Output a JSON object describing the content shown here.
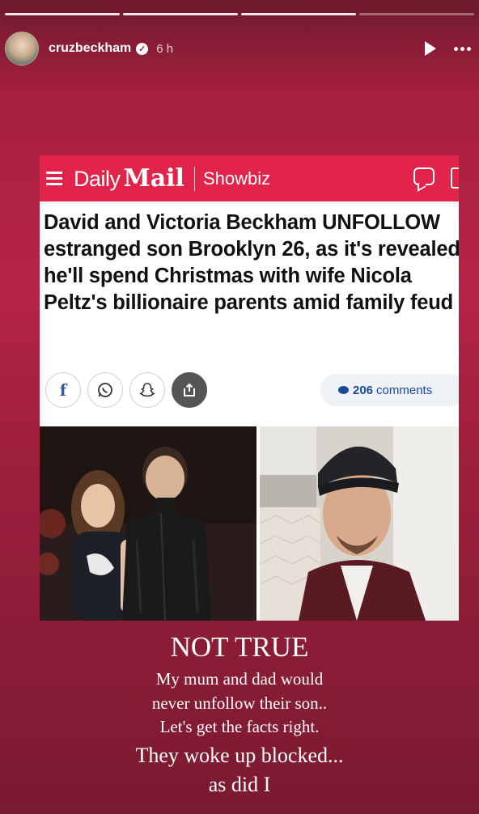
{
  "story": {
    "username": "cruzbeckham",
    "time": "6 h"
  },
  "article": {
    "brand_daily": "Daily",
    "brand_mail": "Mail",
    "section": "Showbiz",
    "headline": "David and Victoria Beckham UNFOLLOW estranged son Brooklyn 26, as it's revealed he'll spend Christmas with wife Nicola Peltz's billionaire parents amid family feud",
    "comments_count": "206",
    "comments_label": "comments"
  },
  "caption": {
    "line1": "NOT TRUE",
    "line2": "My mum and dad would",
    "line3": "never unfollow their son..",
    "line4": "Let's get the facts right.",
    "line5": "They woke up blocked...",
    "line6": "as did I"
  },
  "colors": {
    "daily_mail_red": "#e2234a",
    "story_bg": "#b52345",
    "comments_blue": "#1a4b9b"
  }
}
